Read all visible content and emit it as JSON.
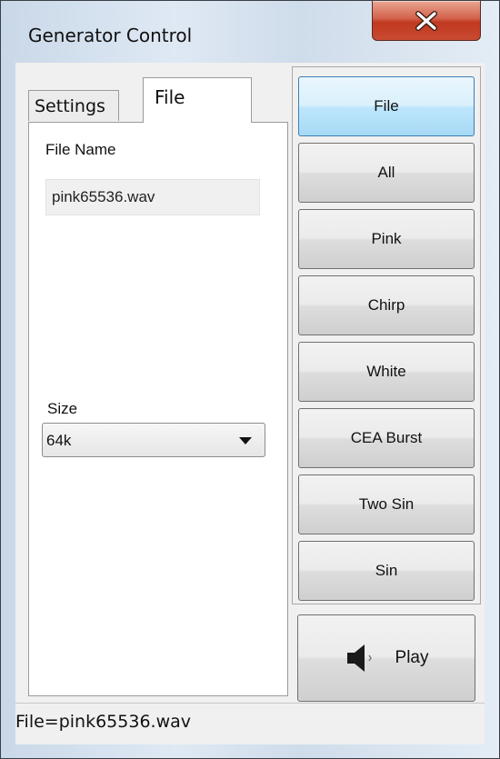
{
  "window": {
    "title": "Generator Control"
  },
  "tabs": [
    {
      "label": "Settings",
      "selected": false
    },
    {
      "label": "File",
      "selected": true
    }
  ],
  "file_tab": {
    "file_name_label": "File Name",
    "file_name_value": "pink65536.wav",
    "size_label": "Size",
    "size_selected": "64k"
  },
  "generator_buttons": [
    {
      "label": "File",
      "active": true
    },
    {
      "label": "All",
      "active": false
    },
    {
      "label": "Pink",
      "active": false
    },
    {
      "label": "Chirp",
      "active": false
    },
    {
      "label": "White",
      "active": false
    },
    {
      "label": "CEA Burst",
      "active": false
    },
    {
      "label": "Two Sin",
      "active": false
    },
    {
      "label": "Sin",
      "active": false
    }
  ],
  "play_button": {
    "label": "Play",
    "icon": "speaker-icon"
  },
  "status": {
    "text": "File=pink65536.wav"
  },
  "colors": {
    "active_button": "#bee6fd",
    "close_button": "#c94a32"
  }
}
